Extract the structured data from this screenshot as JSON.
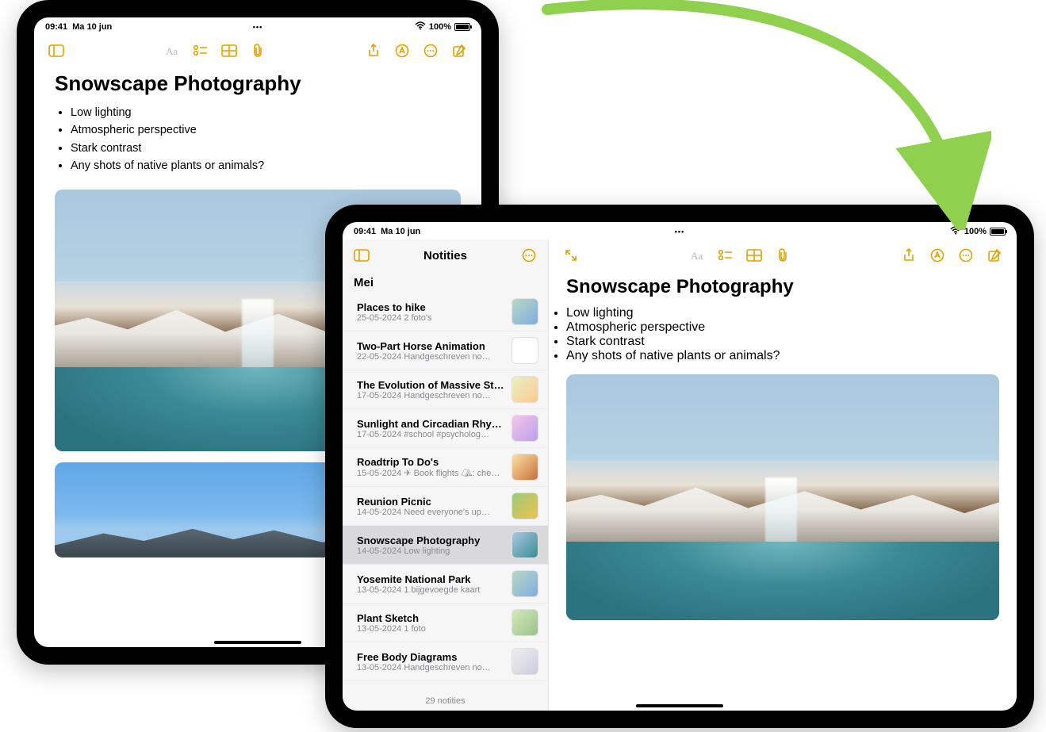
{
  "status": {
    "time": "09:41",
    "date": "Ma 10 jun",
    "wifi": "􀙇",
    "battery_pct": "100%"
  },
  "toolbar_dots": "•••",
  "note": {
    "title": "Snowscape Photography",
    "bullets": [
      "Low lighting",
      "Atmospheric perspective",
      "Stark contrast",
      "Any shots of native plants or animals?"
    ]
  },
  "sidebar": {
    "header": "Notities",
    "section": "Mei",
    "footer": "29 notities",
    "items": [
      {
        "title": "Places to hike",
        "date": "25-05-2024",
        "sub": "2 foto's",
        "thumb": "c0"
      },
      {
        "title": "Two-Part Horse Animation",
        "date": "22-05-2024",
        "sub": "Handgeschreven no…",
        "thumb": "blank"
      },
      {
        "title": "The Evolution of Massive Star…",
        "date": "17-05-2024",
        "sub": "Handgeschreven no…",
        "thumb": "c1"
      },
      {
        "title": "Sunlight and Circadian Rhyth…",
        "date": "17-05-2024",
        "sub": "#school #psycholog…",
        "thumb": "c2"
      },
      {
        "title": "Roadtrip To Do's",
        "date": "15-05-2024",
        "sub": "✈︎ Book flights ⛺︎: che…",
        "thumb": "c3"
      },
      {
        "title": "Reunion Picnic",
        "date": "14-05-2024",
        "sub": "Need everyone's up…",
        "thumb": "c4"
      },
      {
        "title": "Snowscape Photography",
        "date": "14-05-2024",
        "sub": "Low lighting",
        "thumb": "c5",
        "selected": true
      },
      {
        "title": "Yosemite National Park",
        "date": "13-05-2024",
        "sub": "1 bijgevoegde kaart",
        "thumb": ""
      },
      {
        "title": "Plant Sketch",
        "date": "13-05-2024",
        "sub": "1 foto",
        "thumb": "c6"
      },
      {
        "title": "Free Body Diagrams",
        "date": "13-05-2024",
        "sub": "Handgeschreven no…",
        "thumb": "c7"
      }
    ]
  }
}
